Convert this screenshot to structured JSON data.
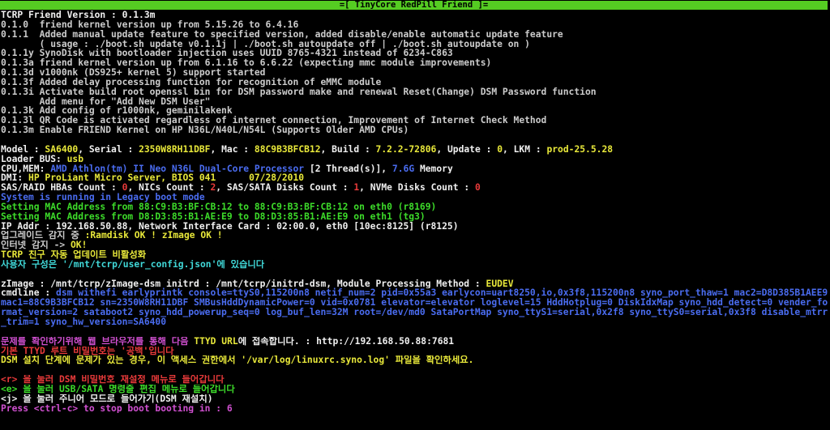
{
  "header": {
    "title": "=[ TinyCore RedPill Friend ]="
  },
  "changelog": [
    "TCRP Friend Version : 0.1.3m",
    "0.1.0  friend kernel version up from 5.15.26 to 6.4.16",
    "0.1.1  Added manual update feature to specified version, added disable/enable automatic update feature",
    "       ( usage : ./boot.sh update v0.1.1j | ./boot.sh autoupdate off | ./boot.sh autoupdate on )",
    "0.1.1y SynoDisk with bootloader injection uses UUID 8765-4321 instead of 6234-C863",
    "0.1.3a friend kernel version up from 6.1.16 to 6.6.22 (expecting mmc module improvements)",
    "0.1.3d v1000nk (DS925+ kernel 5) support started",
    "0.1.3f Added delay processing function for recognition of eMMC module",
    "0.1.3i Activate build root openssl bin for DSM password make and renewal Reset(Change) DSM Password function",
    "       Add menu for \"Add New DSM User\"",
    "0.1.3k Add config of r1000nk, geminilakenk",
    "0.1.3l QR Code is activated regardless of internet connection, Improvement of Internet Check Method",
    "0.1.3m Enable FRIEND Kernel on HP N36L/N40L/N54L (Supports Older AMD CPUs)"
  ],
  "system": {
    "model_label": "Model : ",
    "model": "SA6400",
    "serial_label": ", Serial : ",
    "serial": "2350W8RH11DBF",
    "mac_label": ", Mac : ",
    "mac": "88C9B3BFCB12",
    "build_label": ", Build : ",
    "build": "7.2.2-72806",
    "update_label": ", Update : ",
    "update": "0",
    "lkm_label": ", LKM : ",
    "lkm": "prod-25.5.28",
    "loader_bus_label": "Loader BUS: ",
    "loader_bus": "usb",
    "cpu_mem_label": "CPU,MEM: ",
    "cpu": "AMD Athlon(tm) II Neo N36L Dual-Core Processor",
    "threads": " [2 Thread(s)], ",
    "memory_size": "7.6G",
    "memory_label": " Memory",
    "dmi_label": "DMI: ",
    "dmi": "HP ProLiant Micro Server, BIOS 041      07/28/2010",
    "hba_label": "SAS/RAID HBAs Count : ",
    "hba_count": "0",
    "nic_label": ", NICs Count : ",
    "nic_count": "2",
    "sas_label": ", SAS/SATA Disks Count : ",
    "sas_count": "1",
    "nvme_label": ", NVMe Disks Count : ",
    "nvme_count": "0",
    "boot_mode": "System is running in Legacy boot mode",
    "mac_eth0": "Setting MAC Address from 88:C9:B3:BF:CB:12 to 88:C9:B3:BF:CB:12 on eth0 (r8169)",
    "mac_eth1": "Setting MAC Address from D8:D3:85:B1:AE:E9 to D8:D3:85:B1:AE:E9 on eth1 (tg3)",
    "ip_line": "IP Addr : 192.168.50.88, Network Interface Card : 02:00.0, eth0 [10ec:8125] (r8125)"
  },
  "status": {
    "upgrade_prefix": "업그레이드 감지 중 ",
    "upgrade_result": ":Ramdisk OK ! zImage OK !",
    "internet_prefix": "인터넷 감지 -> ",
    "internet_result": "OK!",
    "auto_update": "TCRP 친구 자동 업데이트 비활성화",
    "config_line": "사용자 구성은 '/mnt/tcrp/user_config.json'에 있습니다"
  },
  "zimage": {
    "prefix": "zImage : /mnt/tcrp/zImage-dsm initrd : /mnt/tcrp/initrd-dsm, Module Processing Method : ",
    "method": "EUDEV"
  },
  "cmdline": {
    "label": "cmdline : ",
    "value": "dsm withefi earlyprintk console=ttyS0,115200n8 netif_num=2 pid=0x55a3 earlycon=uart8250,io,0x3f8,115200n8 syno_port_thaw=1 mac2=D8D385B1AEE9 mac1=88C9B3BFCB12 sn=2350W8RH11DBF SMBusHddDynamicPower=0 vid=0x0781 elevator=elevator loglevel=15 HddHotplug=0 DiskIdxMap syno_hdd_detect=0 vender_format_version=2 sataboot2 syno_hdd_powerup_seq=0 log_buf_len=32M root=/dev/md0 SataPortMap syno_ttyS1=serial,0x2f8 syno_ttyS0=serial,0x3f8 disable_mtrr_trim=1 syno_hw_version=SA6400"
  },
  "help": {
    "ttyd_prefix": "문제를 확인하기위해 웹 브라우저를 통해 다음 ",
    "ttyd_word": "TTYD URL",
    "ttyd_suffix": "에 접속합니다. : http://192.168.50.88:7681",
    "password_line": "기본 TTYD 루트 비밀번호는 '공백'입니다",
    "log_line": "DSM 설치 단계에 문제가 있는 경우, 이 액세스 권한에서 '/var/log/linuxrc.syno.log' 파일을 확인하세요."
  },
  "menu": [
    {
      "key": "<r>",
      "text": " 을 눌러 DSM 비밀번호 재설정 메뉴로 들어갑니다"
    },
    {
      "key": "<e>",
      "text": " 을 눌러 USB/SATA 명령줄 편집 메뉴로 들어갑니다"
    },
    {
      "key": "<j>",
      "text": " 을 눌러 주니어 모드로 들어가기(DSM 재설치)"
    }
  ],
  "countdown": "Press <ctrl-c> to stop boot booting in : 6",
  "colors": {
    "header_bg": "#55cc22",
    "yellow": "#e8e83a",
    "green": "#3ddc2a",
    "blue": "#4a6cf0",
    "red": "#e83a3a",
    "cyan": "#40d8d8",
    "magenta": "#d050d0"
  }
}
